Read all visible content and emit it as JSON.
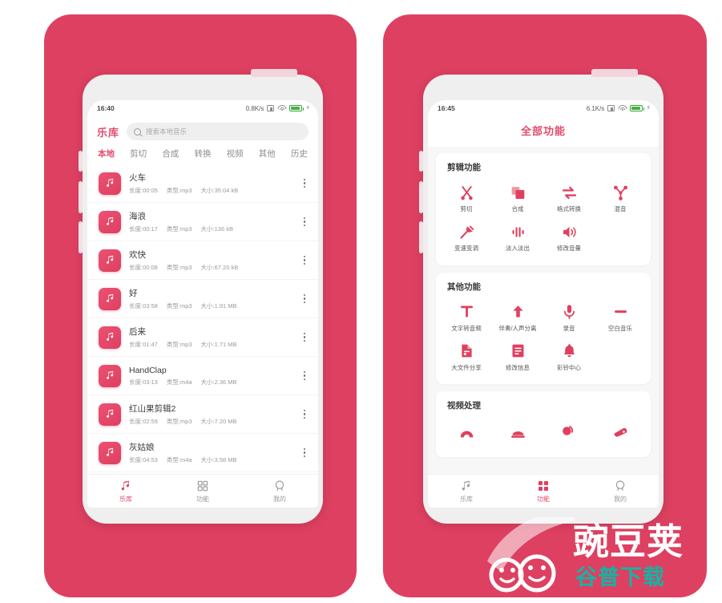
{
  "theme": {
    "brand_pink": "#DE4061",
    "accent_red": "#E24B6B",
    "bg_white": "#FFFFFF",
    "screen_grey": "#F7F7F7",
    "watermark_teal": "#15B3A3"
  },
  "left_phone": {
    "status_bar": {
      "time": "16:40",
      "net_speed": "0.8K/s",
      "sim_icon": "sim-card-icon",
      "wifi_icon": "wifi-icon",
      "battery_icon": "battery-icon",
      "charging_icon": "charging-bolt-icon"
    },
    "header": {
      "title": "乐库",
      "search_placeholder": "搜索本地音乐",
      "search_value": "",
      "search_icon": "search-icon"
    },
    "tabs": [
      {
        "label": "本地",
        "active": true
      },
      {
        "label": "剪切",
        "active": false
      },
      {
        "label": "合成",
        "active": false
      },
      {
        "label": "转换",
        "active": false
      },
      {
        "label": "视频",
        "active": false
      },
      {
        "label": "其他",
        "active": false
      },
      {
        "label": "历史",
        "active": false
      }
    ],
    "song_labels": {
      "duration": "长度:",
      "type": "类型:",
      "size": "大小:"
    },
    "songs": [
      {
        "name": "火车",
        "duration": "长度:00:05",
        "type": "类型:mp3",
        "size": "大小:35.04 kB"
      },
      {
        "name": "海浪",
        "duration": "长度:00:17",
        "type": "类型:mp3",
        "size": "大小:136 kB"
      },
      {
        "name": "欢快",
        "duration": "长度:00:08",
        "type": "类型:mp3",
        "size": "大小:67.20 kB"
      },
      {
        "name": "好",
        "duration": "长度:03:58",
        "type": "类型:mp3",
        "size": "大小:1.91 MB"
      },
      {
        "name": "后来",
        "duration": "长度:01:47",
        "type": "类型:mp3",
        "size": "大小:1.71 MB"
      },
      {
        "name": "HandClap",
        "duration": "长度:03:13",
        "type": "类型:m4a",
        "size": "大小:2.36 MB"
      },
      {
        "name": "红山果剪辑2",
        "duration": "长度:02:59",
        "type": "类型:mp3",
        "size": "大小:7.20 MB"
      },
      {
        "name": "灰姑娘",
        "duration": "长度:04:53",
        "type": "类型:m4a",
        "size": "大小:3.58 MB"
      }
    ],
    "bottom_nav": [
      {
        "label": "乐库",
        "icon": "music-note-icon",
        "active": true
      },
      {
        "label": "功能",
        "icon": "grid-icon",
        "active": false
      },
      {
        "label": "我的",
        "icon": "person-icon",
        "active": false
      }
    ]
  },
  "right_phone": {
    "status_bar": {
      "time": "16:45",
      "net_speed": "6.1K/s",
      "sim_icon": "sim-card-icon",
      "wifi_icon": "wifi-icon",
      "battery_icon": "battery-icon",
      "charging_icon": "charging-bolt-icon"
    },
    "page_title": "全部功能",
    "sections": [
      {
        "title": "剪辑功能",
        "items": [
          {
            "label": "剪切",
            "icon": "scissors-icon"
          },
          {
            "label": "合成",
            "icon": "merge-squares-icon"
          },
          {
            "label": "格式转换",
            "icon": "swap-arrows-icon"
          },
          {
            "label": "混音",
            "icon": "mix-nodes-icon"
          },
          {
            "label": "变速变调",
            "icon": "speed-pitch-icon"
          },
          {
            "label": "淡入淡出",
            "icon": "fade-bars-icon"
          },
          {
            "label": "修改音量",
            "icon": "volume-icon"
          }
        ]
      },
      {
        "title": "其他功能",
        "items": [
          {
            "label": "文字转音频",
            "icon": "text-to-audio-icon"
          },
          {
            "label": "伴奏/人声分离",
            "icon": "vocal-separate-icon"
          },
          {
            "label": "录音",
            "icon": "microphone-icon"
          },
          {
            "label": "空白音乐",
            "icon": "blank-dash-icon"
          },
          {
            "label": "大文件分享",
            "icon": "file-share-icon"
          },
          {
            "label": "修改信息",
            "icon": "edit-info-icon"
          },
          {
            "label": "彩铃中心",
            "icon": "bell-icon"
          }
        ]
      },
      {
        "title": "视频处理",
        "items": [
          {
            "label": "",
            "icon": "video-arch-icon"
          },
          {
            "label": "",
            "icon": "video-dome-icon"
          },
          {
            "label": "",
            "icon": "video-undo-icon"
          },
          {
            "label": "",
            "icon": "video-clip-icon"
          }
        ]
      }
    ],
    "bottom_nav": [
      {
        "label": "乐库",
        "icon": "music-note-icon",
        "active": false
      },
      {
        "label": "功能",
        "icon": "grid-icon",
        "active": true
      },
      {
        "label": "我的",
        "icon": "person-icon",
        "active": false
      }
    ]
  },
  "watermark": {
    "brand": "豌豆荚",
    "sub": "谷普下载",
    "mascot_icon": "wandoujia-pea-mascot-icon"
  }
}
